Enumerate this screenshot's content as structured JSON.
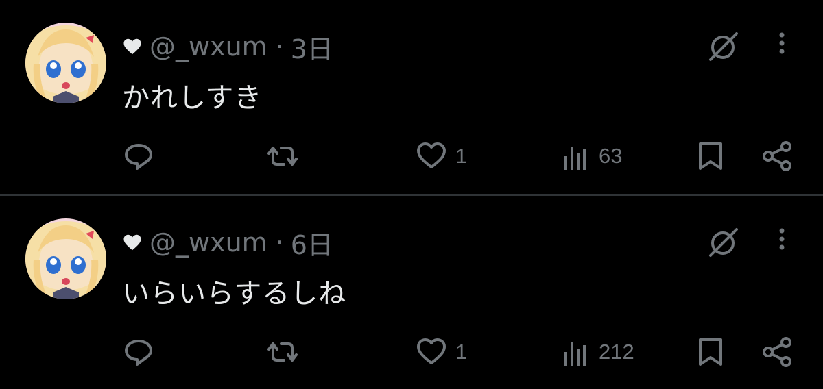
{
  "colors": {
    "background": "#000000",
    "text_primary": "#e7e9ea",
    "text_secondary": "#71767b",
    "divider": "#2f3336"
  },
  "tweets": [
    {
      "handle": "@_wxum",
      "separator": "·",
      "time": "3日",
      "text": "かれしすき",
      "like_count": "1",
      "view_count": "63"
    },
    {
      "handle": "@_wxum",
      "separator": "·",
      "time": "6日",
      "text": "いらいらするしね",
      "like_count": "1",
      "view_count": "212"
    }
  ]
}
